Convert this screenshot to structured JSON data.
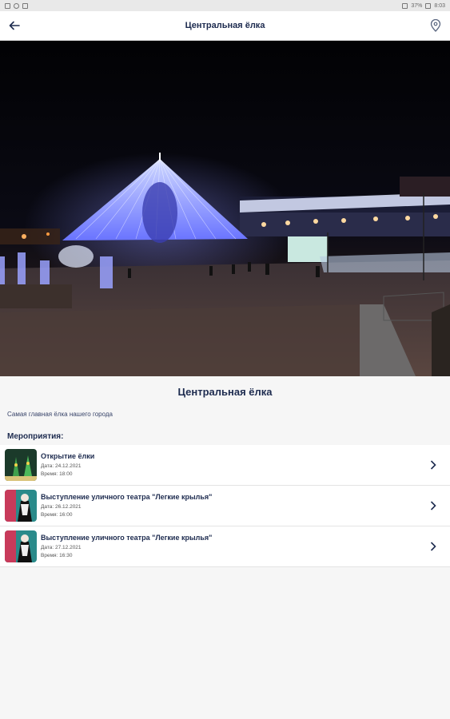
{
  "statusbar": {
    "battery": "37%",
    "time": "8:03"
  },
  "header": {
    "title": "Центральная ёлка",
    "icons": {
      "back": "arrow-left-icon",
      "location": "map-pin-icon"
    }
  },
  "place": {
    "title": "Центральная ёлка",
    "description": "Самая главная ёлка нашего города"
  },
  "events_label": "Мероприятия:",
  "events": [
    {
      "name": "Открытие ёлки",
      "date": "Дата: 24.12.2021",
      "time": "Время: 18:00"
    },
    {
      "name": "Выступление уличного театра \"Легкие крылья\"",
      "date": "Дата: 26.12.2021",
      "time": "Время: 16:00"
    },
    {
      "name": "Выступление уличного театра \"Легкие крылья\"",
      "date": "Дата: 27.12.2021",
      "time": "Время: 16:30"
    }
  ],
  "colors": {
    "accent": "#1d2b4f",
    "background": "#f6f6f6"
  }
}
